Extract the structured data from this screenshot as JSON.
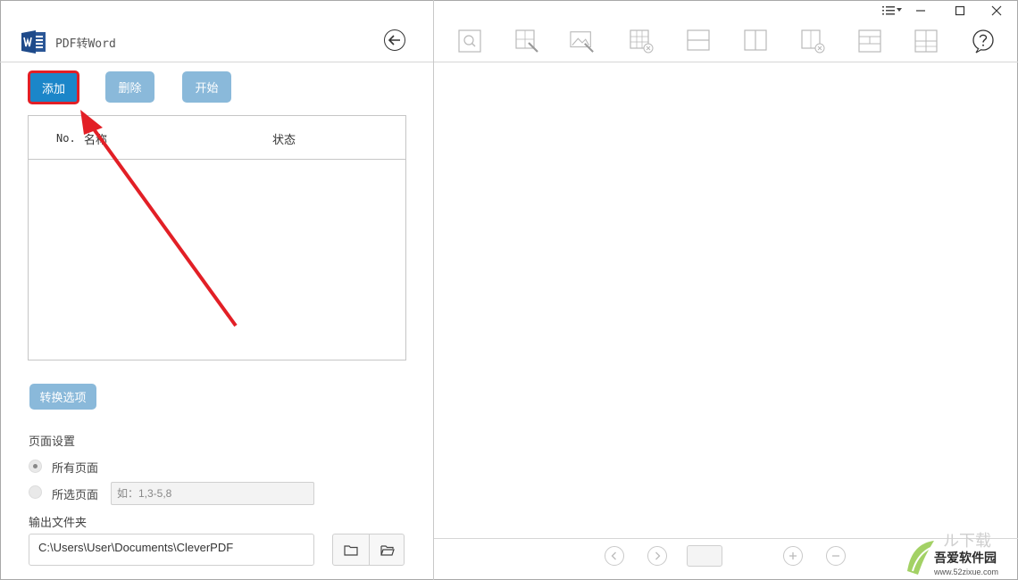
{
  "app": {
    "title": "PDF转Word",
    "logo_icon": "word-logo-icon"
  },
  "toolbar": {
    "add_label": "添加",
    "delete_label": "删除",
    "start_label": "开始"
  },
  "file_table": {
    "columns": [
      "No.",
      "名称",
      "状态"
    ],
    "rows": []
  },
  "options": {
    "convert_options_label": "转换选项",
    "page_settings_label": "页面设置",
    "all_pages_label": "所有页面",
    "selected_pages_label": "所选页面",
    "page_range_placeholder": "如：1,3-5,8",
    "selected_radio": "all_pages"
  },
  "output": {
    "label": "输出文件夹",
    "path": "C:\\Users\\User\\Documents\\CleverPDF"
  },
  "preview_toolbar": {
    "tools": [
      "zoom-icon",
      "text-edit-icon",
      "image-edit-icon",
      "table-delete-icon",
      "split-horizontal-icon",
      "split-vertical-icon",
      "cell-delete-icon",
      "layout-header-icon",
      "grid-icon",
      "help-icon"
    ]
  },
  "window": {
    "menu_icon": "menu-list-icon",
    "minimize_icon": "minimize-icon",
    "maximize_icon": "maximize-icon",
    "close_icon": "close-icon"
  },
  "watermark": {
    "title": "吾爱软件园",
    "url": "www.52zixue.com"
  },
  "colors": {
    "primary": "#1b86c9",
    "disabled": "#8ab9da",
    "highlight": "#e21f26"
  }
}
